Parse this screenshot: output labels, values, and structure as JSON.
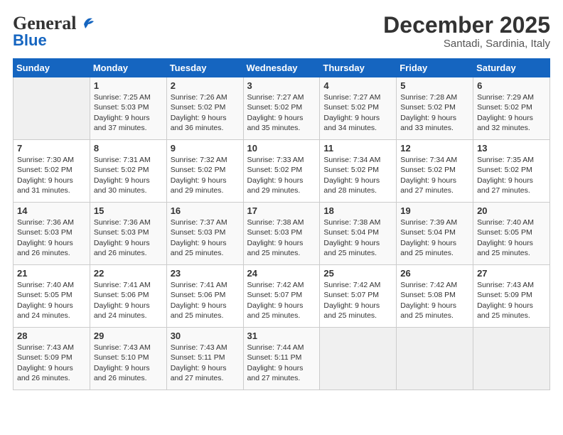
{
  "header": {
    "logo_general": "General",
    "logo_blue": "Blue",
    "month": "December 2025",
    "location": "Santadi, Sardinia, Italy"
  },
  "weekdays": [
    "Sunday",
    "Monday",
    "Tuesday",
    "Wednesday",
    "Thursday",
    "Friday",
    "Saturday"
  ],
  "weeks": [
    [
      {
        "day": "",
        "sunrise": "",
        "sunset": "",
        "daylight": ""
      },
      {
        "day": "1",
        "sunrise": "Sunrise: 7:25 AM",
        "sunset": "Sunset: 5:03 PM",
        "daylight": "Daylight: 9 hours and 37 minutes."
      },
      {
        "day": "2",
        "sunrise": "Sunrise: 7:26 AM",
        "sunset": "Sunset: 5:02 PM",
        "daylight": "Daylight: 9 hours and 36 minutes."
      },
      {
        "day": "3",
        "sunrise": "Sunrise: 7:27 AM",
        "sunset": "Sunset: 5:02 PM",
        "daylight": "Daylight: 9 hours and 35 minutes."
      },
      {
        "day": "4",
        "sunrise": "Sunrise: 7:27 AM",
        "sunset": "Sunset: 5:02 PM",
        "daylight": "Daylight: 9 hours and 34 minutes."
      },
      {
        "day": "5",
        "sunrise": "Sunrise: 7:28 AM",
        "sunset": "Sunset: 5:02 PM",
        "daylight": "Daylight: 9 hours and 33 minutes."
      },
      {
        "day": "6",
        "sunrise": "Sunrise: 7:29 AM",
        "sunset": "Sunset: 5:02 PM",
        "daylight": "Daylight: 9 hours and 32 minutes."
      }
    ],
    [
      {
        "day": "7",
        "sunrise": "Sunrise: 7:30 AM",
        "sunset": "Sunset: 5:02 PM",
        "daylight": "Daylight: 9 hours and 31 minutes."
      },
      {
        "day": "8",
        "sunrise": "Sunrise: 7:31 AM",
        "sunset": "Sunset: 5:02 PM",
        "daylight": "Daylight: 9 hours and 30 minutes."
      },
      {
        "day": "9",
        "sunrise": "Sunrise: 7:32 AM",
        "sunset": "Sunset: 5:02 PM",
        "daylight": "Daylight: 9 hours and 29 minutes."
      },
      {
        "day": "10",
        "sunrise": "Sunrise: 7:33 AM",
        "sunset": "Sunset: 5:02 PM",
        "daylight": "Daylight: 9 hours and 29 minutes."
      },
      {
        "day": "11",
        "sunrise": "Sunrise: 7:34 AM",
        "sunset": "Sunset: 5:02 PM",
        "daylight": "Daylight: 9 hours and 28 minutes."
      },
      {
        "day": "12",
        "sunrise": "Sunrise: 7:34 AM",
        "sunset": "Sunset: 5:02 PM",
        "daylight": "Daylight: 9 hours and 27 minutes."
      },
      {
        "day": "13",
        "sunrise": "Sunrise: 7:35 AM",
        "sunset": "Sunset: 5:02 PM",
        "daylight": "Daylight: 9 hours and 27 minutes."
      }
    ],
    [
      {
        "day": "14",
        "sunrise": "Sunrise: 7:36 AM",
        "sunset": "Sunset: 5:03 PM",
        "daylight": "Daylight: 9 hours and 26 minutes."
      },
      {
        "day": "15",
        "sunrise": "Sunrise: 7:36 AM",
        "sunset": "Sunset: 5:03 PM",
        "daylight": "Daylight: 9 hours and 26 minutes."
      },
      {
        "day": "16",
        "sunrise": "Sunrise: 7:37 AM",
        "sunset": "Sunset: 5:03 PM",
        "daylight": "Daylight: 9 hours and 25 minutes."
      },
      {
        "day": "17",
        "sunrise": "Sunrise: 7:38 AM",
        "sunset": "Sunset: 5:03 PM",
        "daylight": "Daylight: 9 hours and 25 minutes."
      },
      {
        "day": "18",
        "sunrise": "Sunrise: 7:38 AM",
        "sunset": "Sunset: 5:04 PM",
        "daylight": "Daylight: 9 hours and 25 minutes."
      },
      {
        "day": "19",
        "sunrise": "Sunrise: 7:39 AM",
        "sunset": "Sunset: 5:04 PM",
        "daylight": "Daylight: 9 hours and 25 minutes."
      },
      {
        "day": "20",
        "sunrise": "Sunrise: 7:40 AM",
        "sunset": "Sunset: 5:05 PM",
        "daylight": "Daylight: 9 hours and 25 minutes."
      }
    ],
    [
      {
        "day": "21",
        "sunrise": "Sunrise: 7:40 AM",
        "sunset": "Sunset: 5:05 PM",
        "daylight": "Daylight: 9 hours and 24 minutes."
      },
      {
        "day": "22",
        "sunrise": "Sunrise: 7:41 AM",
        "sunset": "Sunset: 5:06 PM",
        "daylight": "Daylight: 9 hours and 24 minutes."
      },
      {
        "day": "23",
        "sunrise": "Sunrise: 7:41 AM",
        "sunset": "Sunset: 5:06 PM",
        "daylight": "Daylight: 9 hours and 25 minutes."
      },
      {
        "day": "24",
        "sunrise": "Sunrise: 7:42 AM",
        "sunset": "Sunset: 5:07 PM",
        "daylight": "Daylight: 9 hours and 25 minutes."
      },
      {
        "day": "25",
        "sunrise": "Sunrise: 7:42 AM",
        "sunset": "Sunset: 5:07 PM",
        "daylight": "Daylight: 9 hours and 25 minutes."
      },
      {
        "day": "26",
        "sunrise": "Sunrise: 7:42 AM",
        "sunset": "Sunset: 5:08 PM",
        "daylight": "Daylight: 9 hours and 25 minutes."
      },
      {
        "day": "27",
        "sunrise": "Sunrise: 7:43 AM",
        "sunset": "Sunset: 5:09 PM",
        "daylight": "Daylight: 9 hours and 25 minutes."
      }
    ],
    [
      {
        "day": "28",
        "sunrise": "Sunrise: 7:43 AM",
        "sunset": "Sunset: 5:09 PM",
        "daylight": "Daylight: 9 hours and 26 minutes."
      },
      {
        "day": "29",
        "sunrise": "Sunrise: 7:43 AM",
        "sunset": "Sunset: 5:10 PM",
        "daylight": "Daylight: 9 hours and 26 minutes."
      },
      {
        "day": "30",
        "sunrise": "Sunrise: 7:43 AM",
        "sunset": "Sunset: 5:11 PM",
        "daylight": "Daylight: 9 hours and 27 minutes."
      },
      {
        "day": "31",
        "sunrise": "Sunrise: 7:44 AM",
        "sunset": "Sunset: 5:11 PM",
        "daylight": "Daylight: 9 hours and 27 minutes."
      },
      {
        "day": "",
        "sunrise": "",
        "sunset": "",
        "daylight": ""
      },
      {
        "day": "",
        "sunrise": "",
        "sunset": "",
        "daylight": ""
      },
      {
        "day": "",
        "sunrise": "",
        "sunset": "",
        "daylight": ""
      }
    ]
  ]
}
